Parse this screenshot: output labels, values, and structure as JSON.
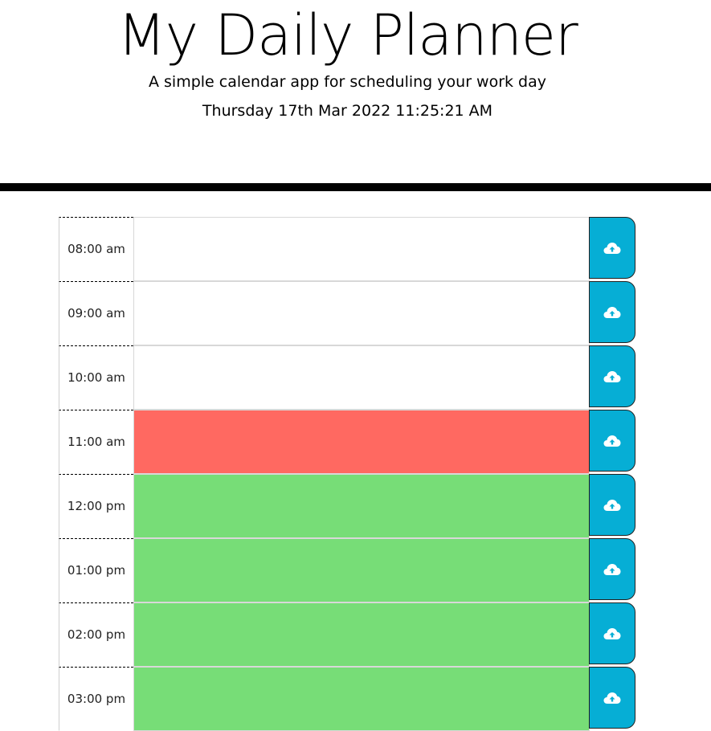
{
  "header": {
    "title": "My Daily Planner",
    "subtitle": "A simple calendar app for scheduling your work day",
    "current_datetime": "Thursday 17th Mar 2022 11:25:21 AM"
  },
  "colors": {
    "past": "#ffffff",
    "present": "#ff6961",
    "future": "#77dd77",
    "save_button": "#06aed5"
  },
  "rows": [
    {
      "hour": "08:00 am",
      "text": "",
      "state": "past",
      "save_icon": "cloud-upload-icon"
    },
    {
      "hour": "09:00 am",
      "text": "",
      "state": "past",
      "save_icon": "cloud-upload-icon"
    },
    {
      "hour": "10:00 am",
      "text": "",
      "state": "past",
      "save_icon": "cloud-upload-icon"
    },
    {
      "hour": "11:00 am",
      "text": "",
      "state": "present",
      "save_icon": "cloud-upload-icon"
    },
    {
      "hour": "12:00 pm",
      "text": "",
      "state": "future",
      "save_icon": "cloud-upload-icon"
    },
    {
      "hour": "01:00 pm",
      "text": "",
      "state": "future",
      "save_icon": "cloud-upload-icon"
    },
    {
      "hour": "02:00 pm",
      "text": "",
      "state": "future",
      "save_icon": "cloud-upload-icon"
    },
    {
      "hour": "03:00 pm",
      "text": "",
      "state": "future",
      "save_icon": "cloud-upload-icon"
    }
  ]
}
